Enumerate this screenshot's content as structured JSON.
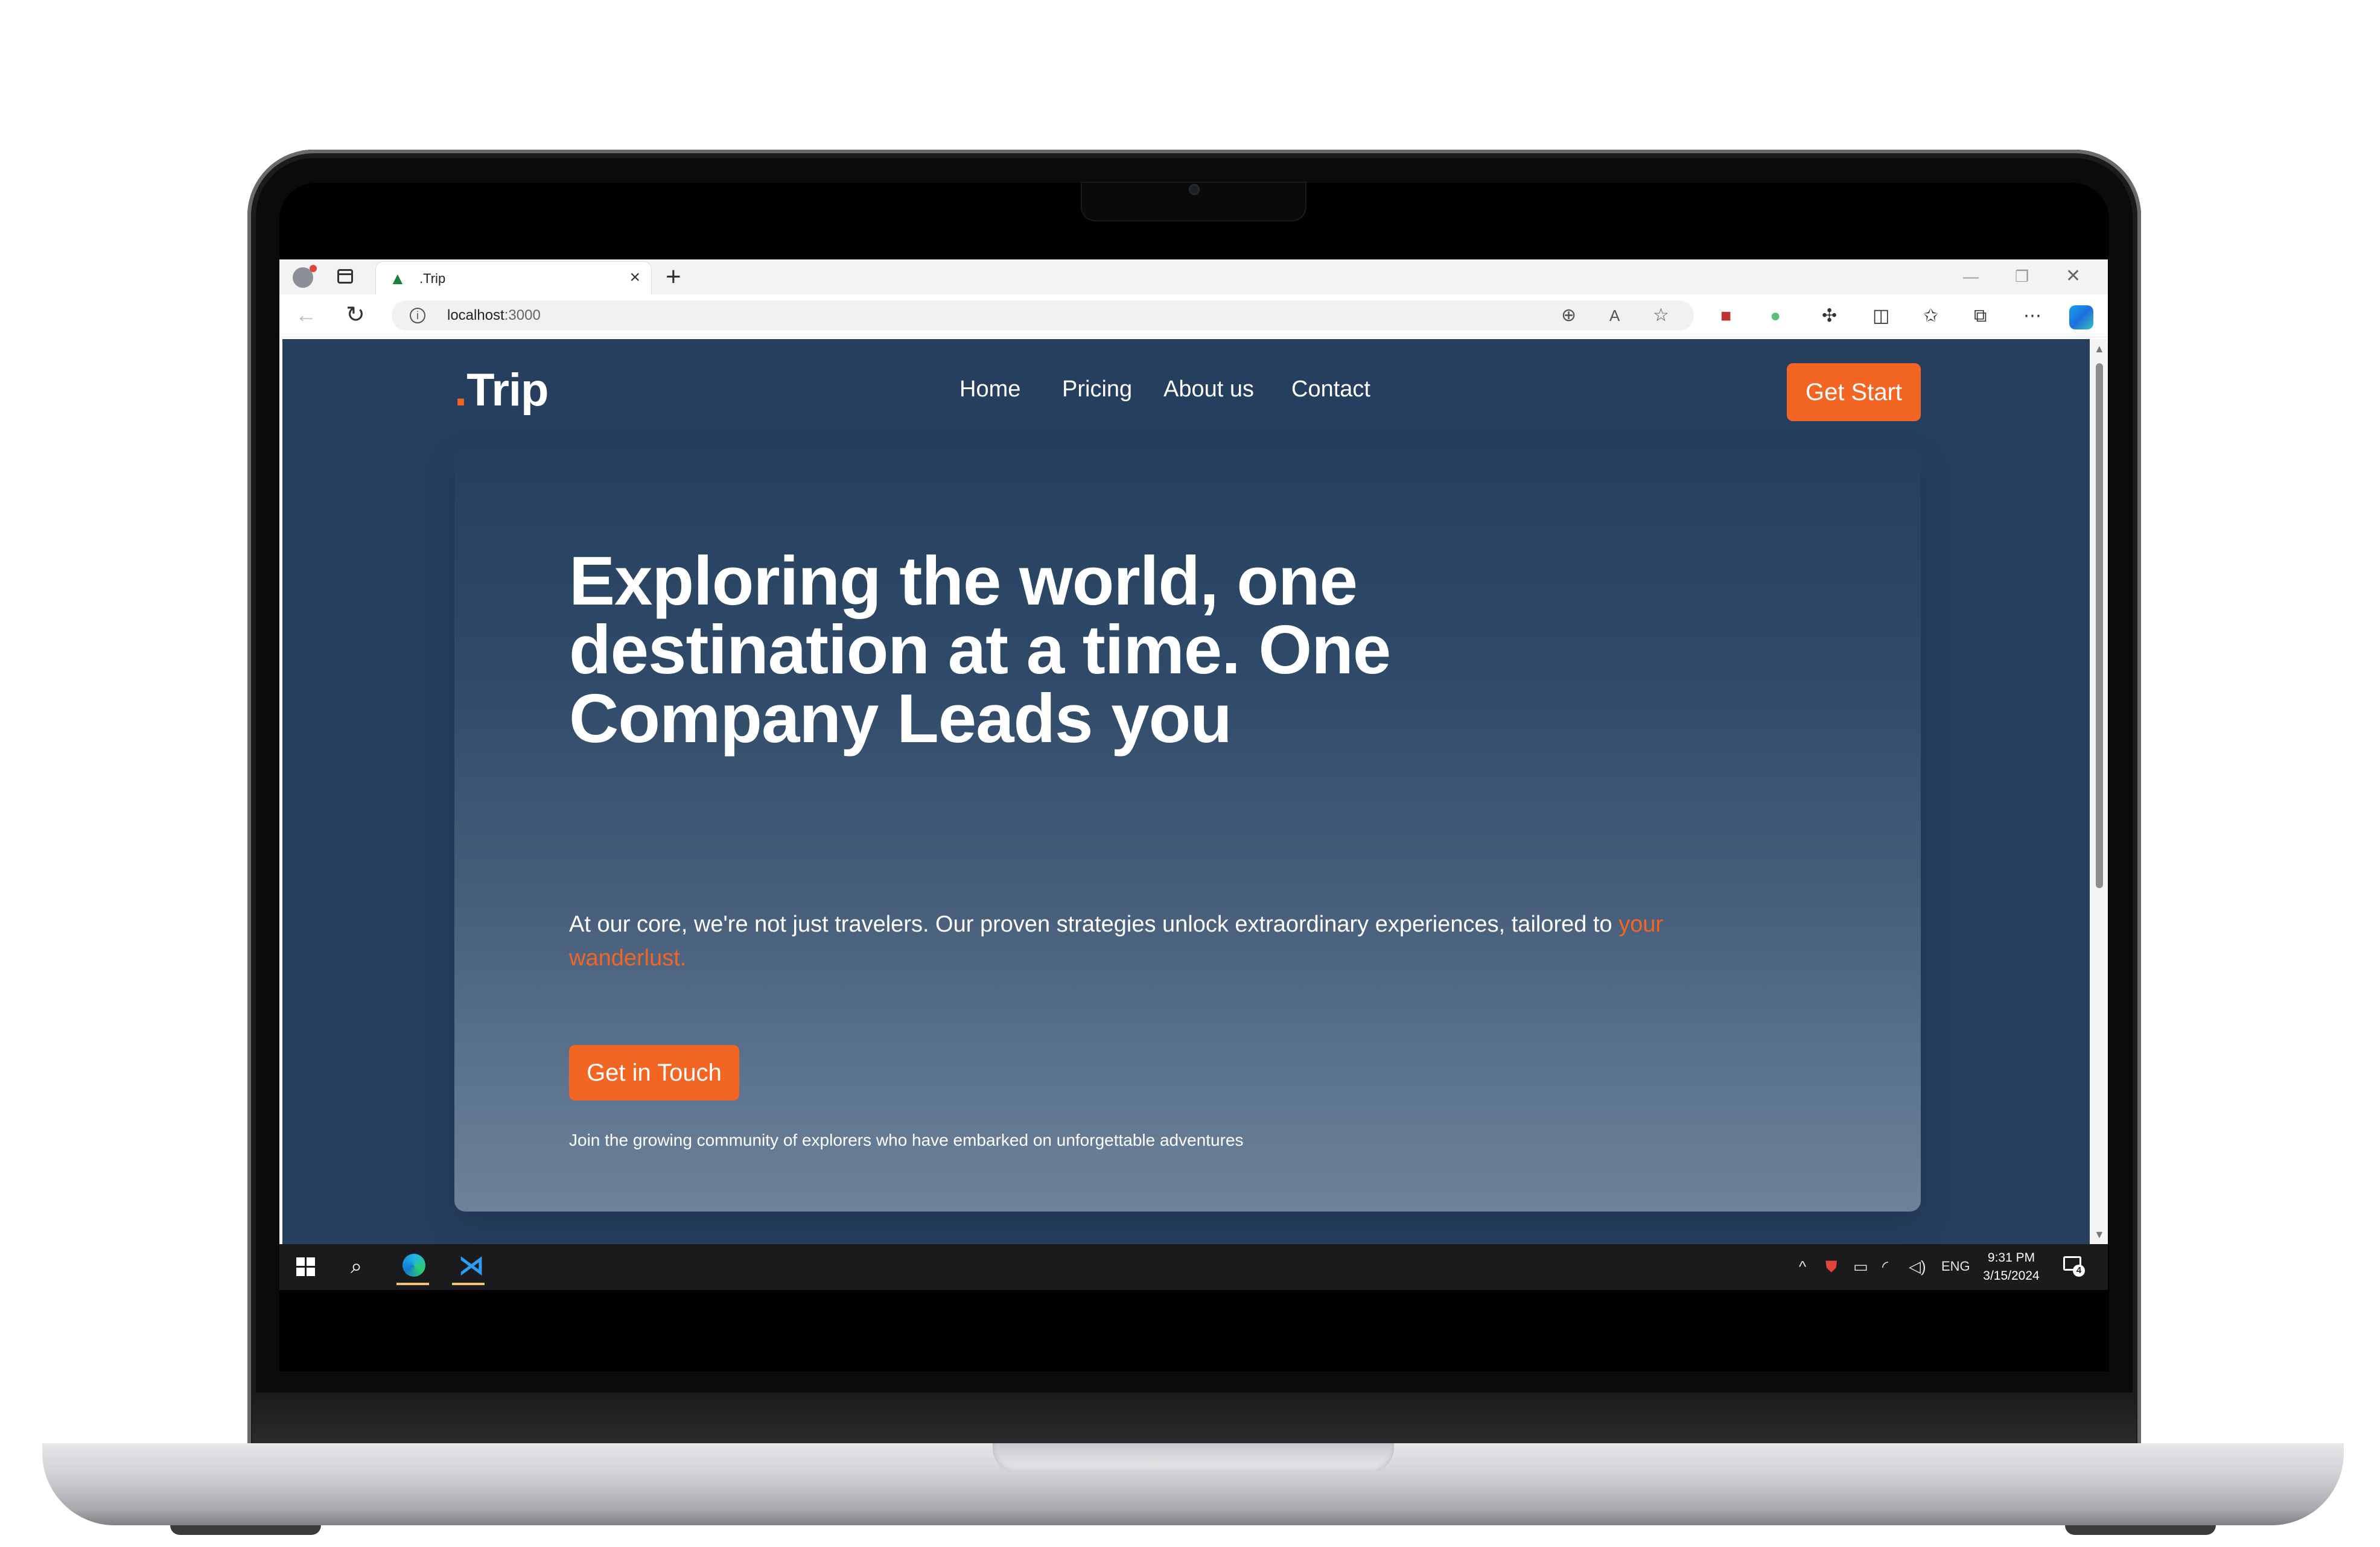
{
  "browser": {
    "tab_title": ".Trip",
    "tab_favicon": "tree-favicon-icon",
    "new_tab": "+",
    "close_tab": "×",
    "url_host": "localhost",
    "url_port": ":3000",
    "window_controls": {
      "minimize": "—",
      "maximize": "❐",
      "close": "✕"
    }
  },
  "site": {
    "logo_dot": ".",
    "logo_text": "Trip",
    "nav": [
      "Home",
      "Pricing",
      "About us",
      "Contact"
    ],
    "cta": "Get Start"
  },
  "hero": {
    "title": "Exploring the world, one destination at a time. One Company Leads you",
    "description": "At our core, we're not just travelers. Our proven strategies unlock extraordinary experiences, tailored to ",
    "description_accent": "your wanderlust.",
    "button": "Get in Touch",
    "note": "Join the growing community of explorers who have embarked on unforgettable adventures"
  },
  "taskbar": {
    "language": "ENG",
    "time": "9:31 PM",
    "date": "3/15/2024",
    "notification_count": "4"
  },
  "colors": {
    "accent": "#f26522",
    "page_background": "#263f5e",
    "taskbar": "#1b1b1d"
  }
}
